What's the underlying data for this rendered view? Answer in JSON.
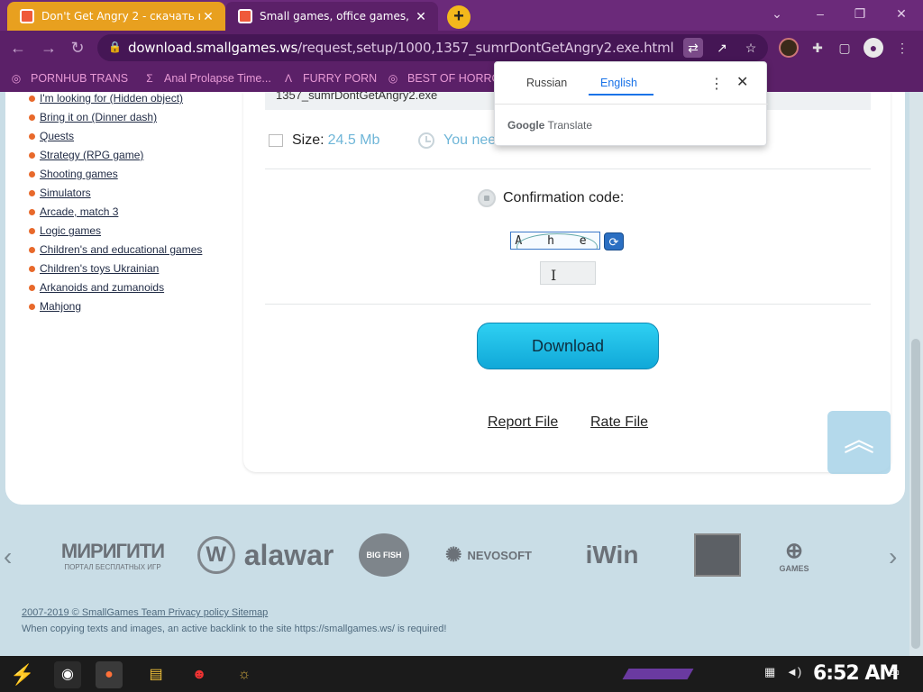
{
  "browser": {
    "tabs": [
      {
        "title": "Don't Get Angry 2 - скачать и",
        "active": false
      },
      {
        "title": "Small games, office games, cas",
        "active": true
      }
    ],
    "new_tab_label": "+",
    "window_controls": {
      "minimize": "⌄",
      "min": "–",
      "restore": "❐",
      "close": "✕"
    },
    "url": {
      "domain": "download.smallgames.ws",
      "path": "/request,setup/1000,1357_sumrDontGetAngry2.exe.html"
    },
    "bookmarks": [
      {
        "label": "PORNHUB TRANS",
        "icon": "globe-icon"
      },
      {
        "label": "Anal Prolapse Time...",
        "icon": "sigma-icon"
      },
      {
        "label": "FURRY PORN",
        "icon": "lambda-icon"
      },
      {
        "label": "BEST OF HORRO",
        "icon": "globe-icon"
      }
    ]
  },
  "translate_popup": {
    "source_lang": "Russian",
    "target_lang": "English",
    "brand_google": "Google",
    "brand_translate": "Translate",
    "accent": "#1a73e8"
  },
  "sidebar": {
    "items": [
      "I'm looking for (Hidden object)",
      "Bring it on (Dinner dash)",
      "Quests",
      "Strategy (RPG game)",
      "Shooting games",
      "Simulators",
      "Arcade, match 3",
      "Logic games",
      "Children's and educational games",
      "Children's toys Ukrainian",
      "Arkanoids and zumanoids",
      "Mahjong"
    ],
    "bullet_color": "#e8692b"
  },
  "download_panel": {
    "filename": "1357_sumrDontGetAngry2.exe",
    "size_label": "Size:",
    "size_value": "24.5 Mb",
    "time_partial": "You nee",
    "confirmation_label": "Confirmation code:",
    "captcha_text": "A h e",
    "download_label": "Download",
    "report_label": "Report File",
    "rate_label": "Rate File",
    "accent": "#10a8d8"
  },
  "partners": [
    {
      "name": "МИРИГИТИ",
      "caption": "ПОРТАЛ БЕСПЛАТНЫХ ИГР"
    },
    {
      "name": "alawar"
    },
    {
      "name": "BIG FISH"
    },
    {
      "name": "NEVOSOFT"
    },
    {
      "name": "iWin"
    },
    {
      "name": "arcade-icon-logo"
    },
    {
      "name": "GAMES"
    }
  ],
  "footer": {
    "copyright": "2007-2019 © SmallGames Team Privacy policy Sitemap",
    "notice": "When copying texts and images, an active backlink to the site https://smallgames.ws/ is required!"
  },
  "taskbar": {
    "clock": "6:52 AM"
  }
}
